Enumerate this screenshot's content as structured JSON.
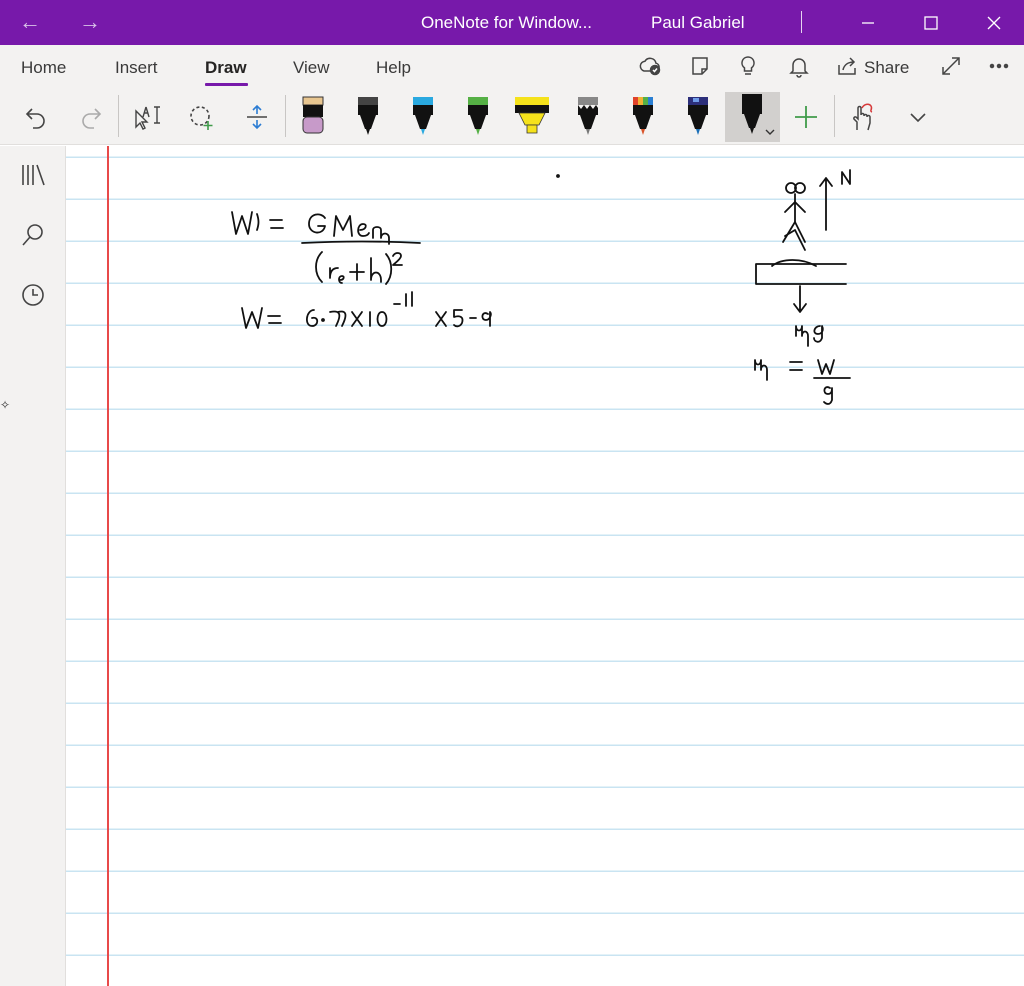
{
  "titlebar": {
    "title": "OneNote for Window...",
    "user": "Paul Gabriel",
    "back_icon": "arrow-left-icon",
    "forward_icon": "arrow-right-icon",
    "brand_color": "#7719aa"
  },
  "ribbon": {
    "tabs": [
      {
        "label": "Home"
      },
      {
        "label": "Insert"
      },
      {
        "label": "Draw",
        "active": true
      },
      {
        "label": "View"
      },
      {
        "label": "Help"
      }
    ],
    "share_label": "Share",
    "pens": [
      {
        "name": "eraser",
        "color": "#c79ac9"
      },
      {
        "name": "black-pen",
        "color": "#111111"
      },
      {
        "name": "blue-pen",
        "color": "#2aa9e0"
      },
      {
        "name": "green-pen",
        "color": "#55b045"
      },
      {
        "name": "yellow-highlighter",
        "color": "#f5e21b"
      },
      {
        "name": "sparkle-pen",
        "color": "#333333"
      },
      {
        "name": "rainbow-pen",
        "color": "#d9542a"
      },
      {
        "name": "galaxy-pen",
        "color": "#1a6fb8"
      },
      {
        "name": "black-pen-selected",
        "color": "#111111"
      }
    ]
  },
  "ink_colors": {
    "margin": "#e84a4a",
    "rule": "#c9e4f2"
  }
}
